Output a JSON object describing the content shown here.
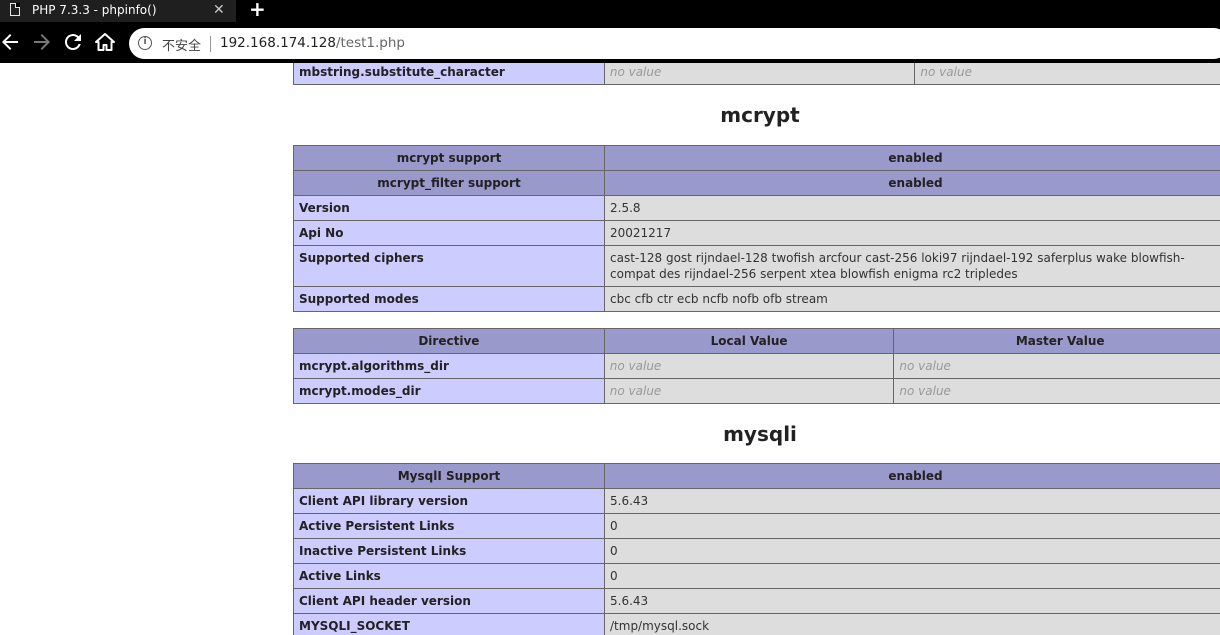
{
  "browser": {
    "tab_title": "PHP 7.3.3 - phpinfo()",
    "close_glyph": "✕",
    "new_tab_glyph": "+",
    "security_label": "不安全",
    "url_host": "192.168.174.128",
    "url_path": "/test1.php"
  },
  "top_row": {
    "name": "mbstring.substitute_character",
    "local": "no value",
    "master": "no value"
  },
  "mcrypt": {
    "title": "mcrypt",
    "support_rows": [
      {
        "name": "mcrypt support",
        "value": "enabled"
      },
      {
        "name": "mcrypt_filter support",
        "value": "enabled"
      }
    ],
    "info_rows": [
      {
        "name": "Version",
        "value": "2.5.8"
      },
      {
        "name": "Api No",
        "value": "20021217"
      },
      {
        "name": "Supported ciphers",
        "value": "cast-128 gost rijndael-128 twofish arcfour cast-256 loki97 rijndael-192 saferplus wake blowfish-compat des rijndael-256 serpent xtea blowfish enigma rc2 tripledes"
      },
      {
        "name": "Supported modes",
        "value": "cbc cfb ctr ecb ncfb nofb ofb stream"
      }
    ],
    "directive_headers": {
      "directive": "Directive",
      "local": "Local Value",
      "master": "Master Value"
    },
    "directives": [
      {
        "name": "mcrypt.algorithms_dir",
        "local": "no value",
        "master": "no value"
      },
      {
        "name": "mcrypt.modes_dir",
        "local": "no value",
        "master": "no value"
      }
    ]
  },
  "mysqli": {
    "title": "mysqli",
    "support_row": {
      "name": "MysqlI Support",
      "value": "enabled"
    },
    "info_rows": [
      {
        "name": "Client API library version",
        "value": "5.6.43"
      },
      {
        "name": "Active Persistent Links",
        "value": "0"
      },
      {
        "name": "Inactive Persistent Links",
        "value": "0"
      },
      {
        "name": "Active Links",
        "value": "0"
      },
      {
        "name": "Client API header version",
        "value": "5.6.43"
      },
      {
        "name": "MYSQLI_SOCKET",
        "value": "/tmp/mysql.sock"
      }
    ]
  },
  "colors": {
    "header_bg": "#9999cc",
    "entry_bg": "#ccccff",
    "value_bg": "#dddddd",
    "no_value_text": "#999999"
  }
}
